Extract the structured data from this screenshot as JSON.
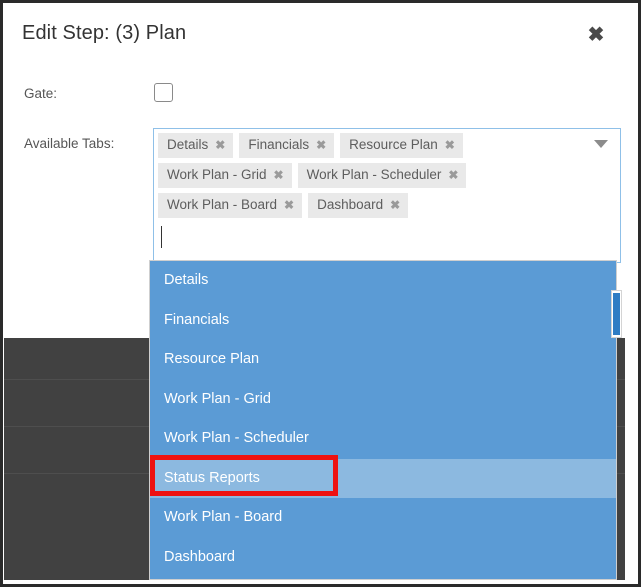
{
  "dialog": {
    "title": "Edit Step: (3) Plan",
    "close_icon": "close-x-icon"
  },
  "form": {
    "gate": {
      "label": "Gate:",
      "checked": false
    },
    "available_tabs": {
      "label": "Available Tabs:",
      "caret_icon": "chevron-down-icon",
      "input_value": "",
      "selected_chips": [
        {
          "label": "Details",
          "remove_icon": "✖"
        },
        {
          "label": "Financials",
          "remove_icon": "✖"
        },
        {
          "label": "Resource Plan",
          "remove_icon": "✖"
        },
        {
          "label": "Work Plan - Grid",
          "remove_icon": "✖"
        },
        {
          "label": "Work Plan - Scheduler",
          "remove_icon": "✖"
        },
        {
          "label": "Work Plan - Board",
          "remove_icon": "✖"
        },
        {
          "label": "Dashboard",
          "remove_icon": "✖"
        }
      ]
    }
  },
  "dropdown": {
    "options": [
      {
        "label": "Details",
        "hovered": false
      },
      {
        "label": "Financials",
        "hovered": false
      },
      {
        "label": "Resource Plan",
        "hovered": false
      },
      {
        "label": "Work Plan - Grid",
        "hovered": false
      },
      {
        "label": "Work Plan - Scheduler",
        "hovered": false
      },
      {
        "label": "Status Reports",
        "hovered": true
      },
      {
        "label": "Work Plan - Board",
        "hovered": false
      },
      {
        "label": "Dashboard",
        "hovered": false
      }
    ]
  },
  "annotation": {
    "target_label": "Status Reports",
    "color": "#ee1111"
  },
  "colors": {
    "dropdown_background": "#5b9bd5",
    "dropdown_hover": "#8cb9e0",
    "chip_background": "#e9e9e9",
    "page_backdrop": "#414141",
    "scrollbar_thumb": "#2e7cc4",
    "field_border": "#8fc0e8"
  }
}
